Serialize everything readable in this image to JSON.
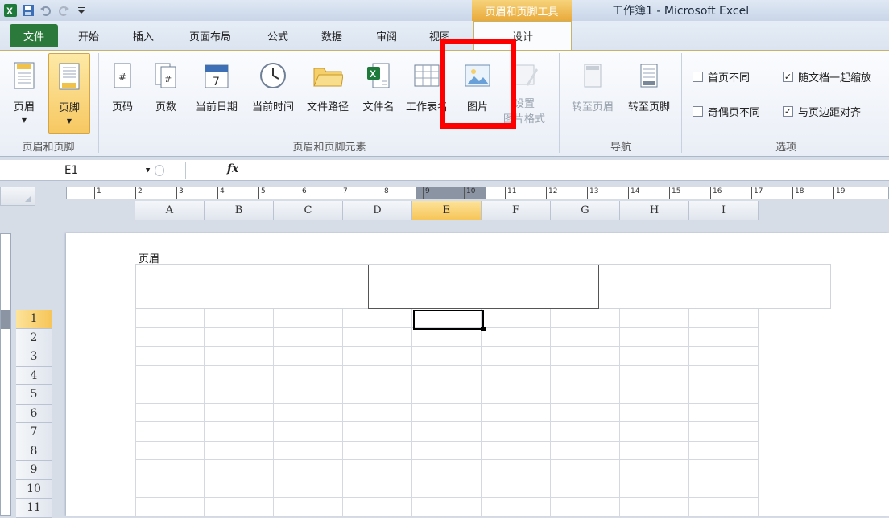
{
  "title_bar": {
    "context_title": "页眉和页脚工具",
    "app_title": "工作簿1 - Microsoft Excel",
    "qat_icons": [
      "excel-logo-icon",
      "save-icon",
      "undo-icon",
      "redo-icon",
      "customize-icon"
    ]
  },
  "tabs": [
    {
      "label": "文件"
    },
    {
      "label": "开始"
    },
    {
      "label": "插入"
    },
    {
      "label": "页面布局"
    },
    {
      "label": "公式"
    },
    {
      "label": "数据"
    },
    {
      "label": "审阅"
    },
    {
      "label": "视图"
    },
    {
      "label": "设计"
    }
  ],
  "ribbon": {
    "groups": [
      {
        "label": "页眉和页脚"
      },
      {
        "label": "页眉和页脚元素"
      },
      {
        "label": "导航"
      },
      {
        "label": "选项"
      }
    ],
    "buttons": {
      "header": "页眉",
      "footer": "页脚",
      "page_number": "页码",
      "page_count": "页数",
      "current_date": "当前日期",
      "current_time": "当前时间",
      "file_path": "文件路径",
      "file_name": "文件名",
      "sheet_name": "工作表名",
      "picture": "图片",
      "format_picture_1": "设置",
      "format_picture_2": "图片格式",
      "goto_header": "转至页眉",
      "goto_footer": "转至页脚"
    },
    "options": [
      {
        "label": "首页不同",
        "checked": false
      },
      {
        "label": "随文档一起缩放",
        "checked": true
      },
      {
        "label": "奇偶页不同",
        "checked": false
      },
      {
        "label": "与页边距对齐",
        "checked": true
      }
    ]
  },
  "formula_bar": {
    "name_box": "E1",
    "fx": "fx",
    "value": ""
  },
  "sheet": {
    "columns": [
      "A",
      "B",
      "C",
      "D",
      "E",
      "F",
      "G",
      "H",
      "I"
    ],
    "active_column": "E",
    "rows": [
      "1",
      "2",
      "3",
      "4",
      "5",
      "6",
      "7",
      "8",
      "9",
      "10",
      "11"
    ],
    "active_row": "1",
    "header_label": "页眉",
    "ruler_numbers": [
      "1",
      "2",
      "3",
      "4",
      "5",
      "6",
      "7",
      "8",
      "9",
      "10",
      "11",
      "12",
      "13",
      "14",
      "15",
      "16",
      "17",
      "18",
      "19"
    ]
  },
  "colors": {
    "file_tab": "#2b7a3b",
    "context_tab": "#e9a93a",
    "highlight": "#ff0000",
    "active_header": "#f6c558"
  }
}
